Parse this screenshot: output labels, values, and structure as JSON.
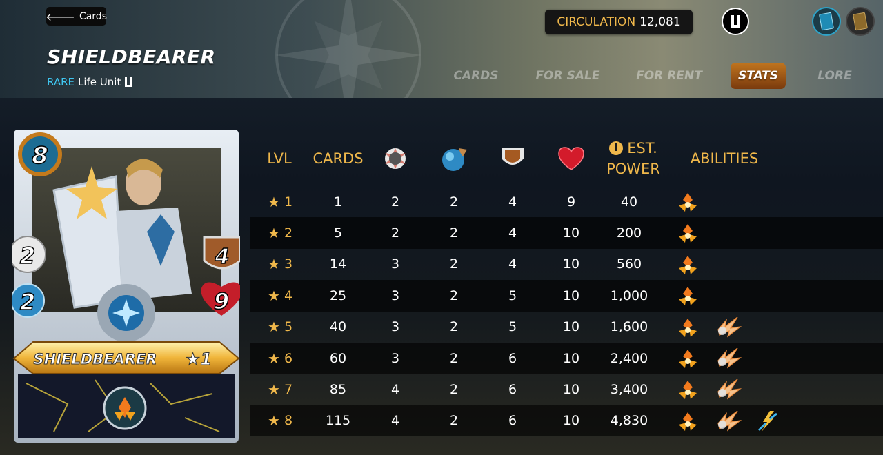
{
  "header": {
    "back_label": "Cards",
    "card_name": "SHIELDBEARER",
    "rarity": "RARE",
    "unit_type": "Life Unit",
    "circulation_label": "CIRCULATION",
    "circulation_value": "12,081",
    "tabs": [
      {
        "label": "CARDS",
        "active": false
      },
      {
        "label": "FOR SALE",
        "active": false
      },
      {
        "label": "FOR RENT",
        "active": false
      },
      {
        "label": "STATS",
        "active": true
      },
      {
        "label": "LORE",
        "active": false
      }
    ]
  },
  "card": {
    "mana": "8",
    "attack": "2",
    "speed": "2",
    "armor": "4",
    "health": "9",
    "name": "SHIELDBEARER",
    "level": "★1"
  },
  "table": {
    "columns": {
      "lvl": "LVL",
      "cards": "CARDS",
      "attack_icon": "melee-attack-icon",
      "speed_icon": "speed-icon",
      "armor_icon": "armor-shield-icon",
      "health_icon": "heart-icon",
      "est_power_line1": "EST.",
      "est_power_line2": "POWER",
      "abilities": "ABILITIES"
    },
    "rows": [
      {
        "lvl": "1",
        "cards": "1",
        "attack": "2",
        "speed": "2",
        "armor": "4",
        "health": "9",
        "power": "40",
        "abilities": [
          "taunt"
        ]
      },
      {
        "lvl": "2",
        "cards": "5",
        "attack": "2",
        "speed": "2",
        "armor": "4",
        "health": "10",
        "power": "200",
        "abilities": [
          "taunt"
        ]
      },
      {
        "lvl": "3",
        "cards": "14",
        "attack": "3",
        "speed": "2",
        "armor": "4",
        "health": "10",
        "power": "560",
        "abilities": [
          "taunt"
        ]
      },
      {
        "lvl": "4",
        "cards": "25",
        "attack": "3",
        "speed": "2",
        "armor": "5",
        "health": "10",
        "power": "1,000",
        "abilities": [
          "taunt"
        ]
      },
      {
        "lvl": "5",
        "cards": "40",
        "attack": "3",
        "speed": "2",
        "armor": "5",
        "health": "10",
        "power": "1,600",
        "abilities": [
          "taunt",
          "shatter"
        ]
      },
      {
        "lvl": "6",
        "cards": "60",
        "attack": "3",
        "speed": "2",
        "armor": "6",
        "health": "10",
        "power": "2,400",
        "abilities": [
          "taunt",
          "shatter"
        ]
      },
      {
        "lvl": "7",
        "cards": "85",
        "attack": "4",
        "speed": "2",
        "armor": "6",
        "health": "10",
        "power": "3,400",
        "abilities": [
          "taunt",
          "shatter"
        ]
      },
      {
        "lvl": "8",
        "cards": "115",
        "attack": "4",
        "speed": "2",
        "armor": "6",
        "health": "10",
        "power": "4,830",
        "abilities": [
          "taunt",
          "shatter",
          "reflection-shield"
        ]
      }
    ]
  },
  "colors": {
    "accent_gold": "#f0b84b",
    "rarity_blue": "#3fc6f0",
    "active_tab": "#c0751f"
  }
}
